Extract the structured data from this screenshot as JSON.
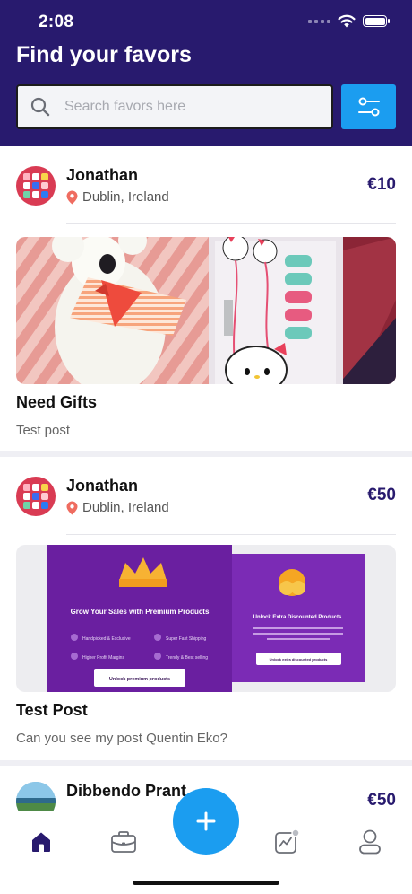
{
  "status": {
    "time": "2:08"
  },
  "header": {
    "title": "Find your favors",
    "search_placeholder": "Search favors here"
  },
  "posts": [
    {
      "user": "Jonathan",
      "location": "Dublin, Ireland",
      "price": "€10",
      "title": "Need Gifts",
      "description": "Test post"
    },
    {
      "user": "Jonathan",
      "location": "Dublin, Ireland",
      "price": "€50",
      "title": "Test Post",
      "description": "Can you see my post Quentin Eko?",
      "promo": {
        "heading": "Grow Your Sales with Premium Products",
        "features": [
          "Handpicked & Exclusive",
          "Super Fast Shipping",
          "Higher Profit Margins",
          "Trendy & Best selling"
        ],
        "cta": "Unlock premium products",
        "side_heading": "Unlock Extra Discounted Products",
        "side_text": "Low margins can be a real bummer. So we partnered with select suppliers to offer the LOWEST prices on the GREATEST products.",
        "side_cta": "Unlock extra discounted products"
      }
    },
    {
      "user": "Dibbendo Prant",
      "price": "€50"
    }
  ],
  "tabbar": {
    "active": "home",
    "icons": [
      "home-icon",
      "briefcase-icon",
      "add-icon",
      "chart-icon",
      "profile-icon"
    ]
  },
  "colors": {
    "header_bg": "#281a6e",
    "accent": "#1b9df0",
    "price": "#281a6e"
  }
}
